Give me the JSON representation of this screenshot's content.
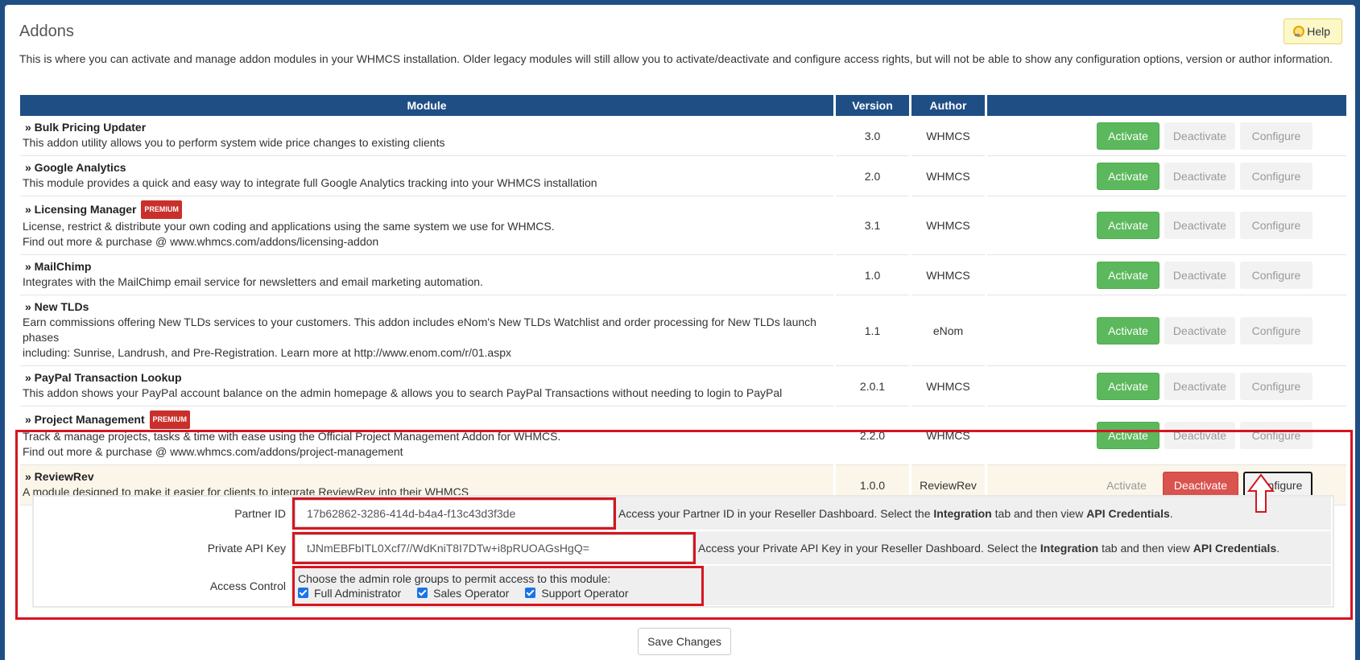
{
  "page": {
    "title": "Addons",
    "help_label": "Help",
    "intro": "This is where you can activate and manage addon modules in your WHMCS installation. Older legacy modules will still allow you to activate/deactivate and configure access rights, but will not be able to show any configuration options, version or author information."
  },
  "table": {
    "headers": {
      "module": "Module",
      "version": "Version",
      "author": "Author",
      "actions": ""
    },
    "buttons": {
      "activate": "Activate",
      "deactivate": "Deactivate",
      "configure": "Configure"
    },
    "premium_badge": "PREMIUM",
    "rows": [
      {
        "name": "» Bulk Pricing Updater",
        "desc1": "This addon utility allows you to perform system wide price changes to existing clients",
        "desc2": "",
        "version": "3.0",
        "author": "WHMCS"
      },
      {
        "name": "» Google Analytics",
        "desc1": "This module provides a quick and easy way to integrate full Google Analytics tracking into your WHMCS installation",
        "desc2": "",
        "version": "2.0",
        "author": "WHMCS"
      },
      {
        "name": "» Licensing Manager",
        "desc1": "License, restrict & distribute your own coding and applications using the same system we use for WHMCS.",
        "desc2": "Find out more & purchase @ www.whmcs.com/addons/licensing-addon",
        "version": "3.1",
        "author": "WHMCS"
      },
      {
        "name": "» MailChimp",
        "desc1": "Integrates with the MailChimp email service for newsletters and email marketing automation.",
        "desc2": "",
        "version": "1.0",
        "author": "WHMCS"
      },
      {
        "name": "» New TLDs",
        "desc1": "Earn commissions offering New TLDs services to your customers. This addon includes eNom's New TLDs Watchlist and order processing for New TLDs launch phases",
        "desc2": "including: Sunrise, Landrush, and Pre-Registration. Learn more at http://www.enom.com/r/01.aspx",
        "version": "1.1",
        "author": "eNom"
      },
      {
        "name": "» PayPal Transaction Lookup",
        "desc1": "This addon shows your PayPal account balance on the admin homepage & allows you to search PayPal Transactions without needing to login to PayPal",
        "desc2": "",
        "version": "2.0.1",
        "author": "WHMCS"
      },
      {
        "name": "» Project Management",
        "desc1": "Track & manage projects, tasks & time with ease using the Official Project Management Addon for WHMCS.",
        "desc2": "Find out more & purchase @ www.whmcs.com/addons/project-management",
        "version": "2.2.0",
        "author": "WHMCS"
      },
      {
        "name": "» ReviewRev",
        "desc1": "A module designed to make it easier for clients to integrate ReviewRev into their WHMCS",
        "desc2": "",
        "version": "1.0.0",
        "author": "ReviewRev"
      }
    ]
  },
  "config": {
    "partner_id": {
      "label": "Partner ID",
      "value": "17b62862-3286-414d-b4a4-f13c43d3f3de",
      "hint_pre": "Access your Partner ID in your Reseller Dashboard. Select the ",
      "hint_b1": "Integration",
      "hint_mid": " tab and then view ",
      "hint_b2": "API Credentials",
      "hint_end": "."
    },
    "api_key": {
      "label": "Private API Key",
      "value": "tJNmEBFbITL0Xcf7//WdKniT8I7DTw+i8pRUOAGsHgQ=",
      "hint_pre": "Access your Private API Key in your Reseller Dashboard. Select the ",
      "hint_b1": "Integration",
      "hint_mid": " tab and then view ",
      "hint_b2": "API Credentials",
      "hint_end": "."
    },
    "access": {
      "label": "Access Control",
      "intro": "Choose the admin role groups to permit access to this module:",
      "roles": [
        "Full Administrator",
        "Sales Operator",
        "Support Operator"
      ]
    }
  },
  "save_label": "Save Changes",
  "colors": {
    "header": "#1f4e85",
    "activate": "#5cb85c",
    "deactivate": "#d9534f",
    "highlight": "#d7141f"
  }
}
